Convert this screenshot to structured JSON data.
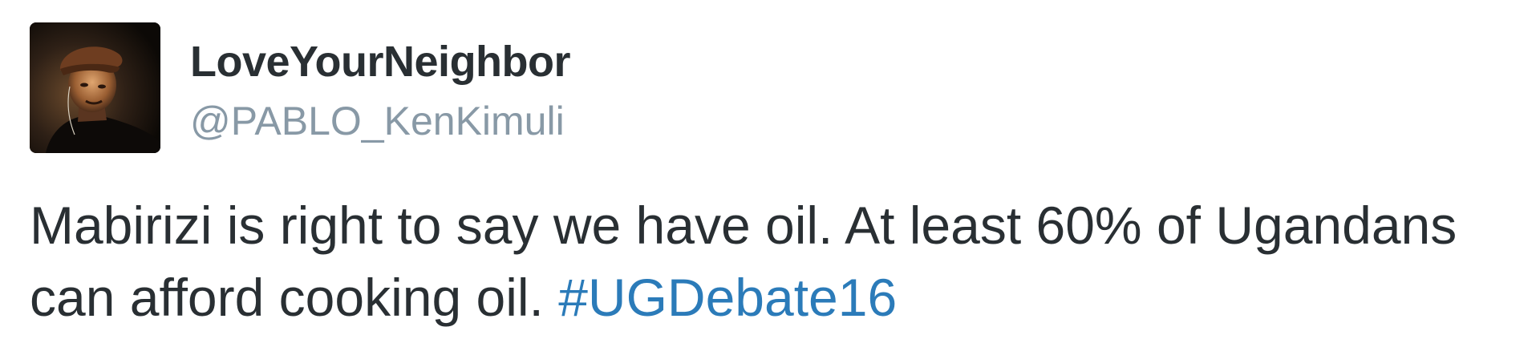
{
  "user": {
    "display_name": "LoveYourNeighbor",
    "handle": "@PABLO_KenKimuli",
    "avatar_icon": "profile-photo"
  },
  "tweet": {
    "text_line_1": "Mabirizi is right to say we have oil. At least 60% of Ugandans",
    "text_line_2": "can afford cooking oil. ",
    "hashtag": "#UGDebate16"
  },
  "colors": {
    "name": "#292f33",
    "handle": "#8899a6",
    "text": "#292f33",
    "hashtag": "#2b7bb9"
  }
}
